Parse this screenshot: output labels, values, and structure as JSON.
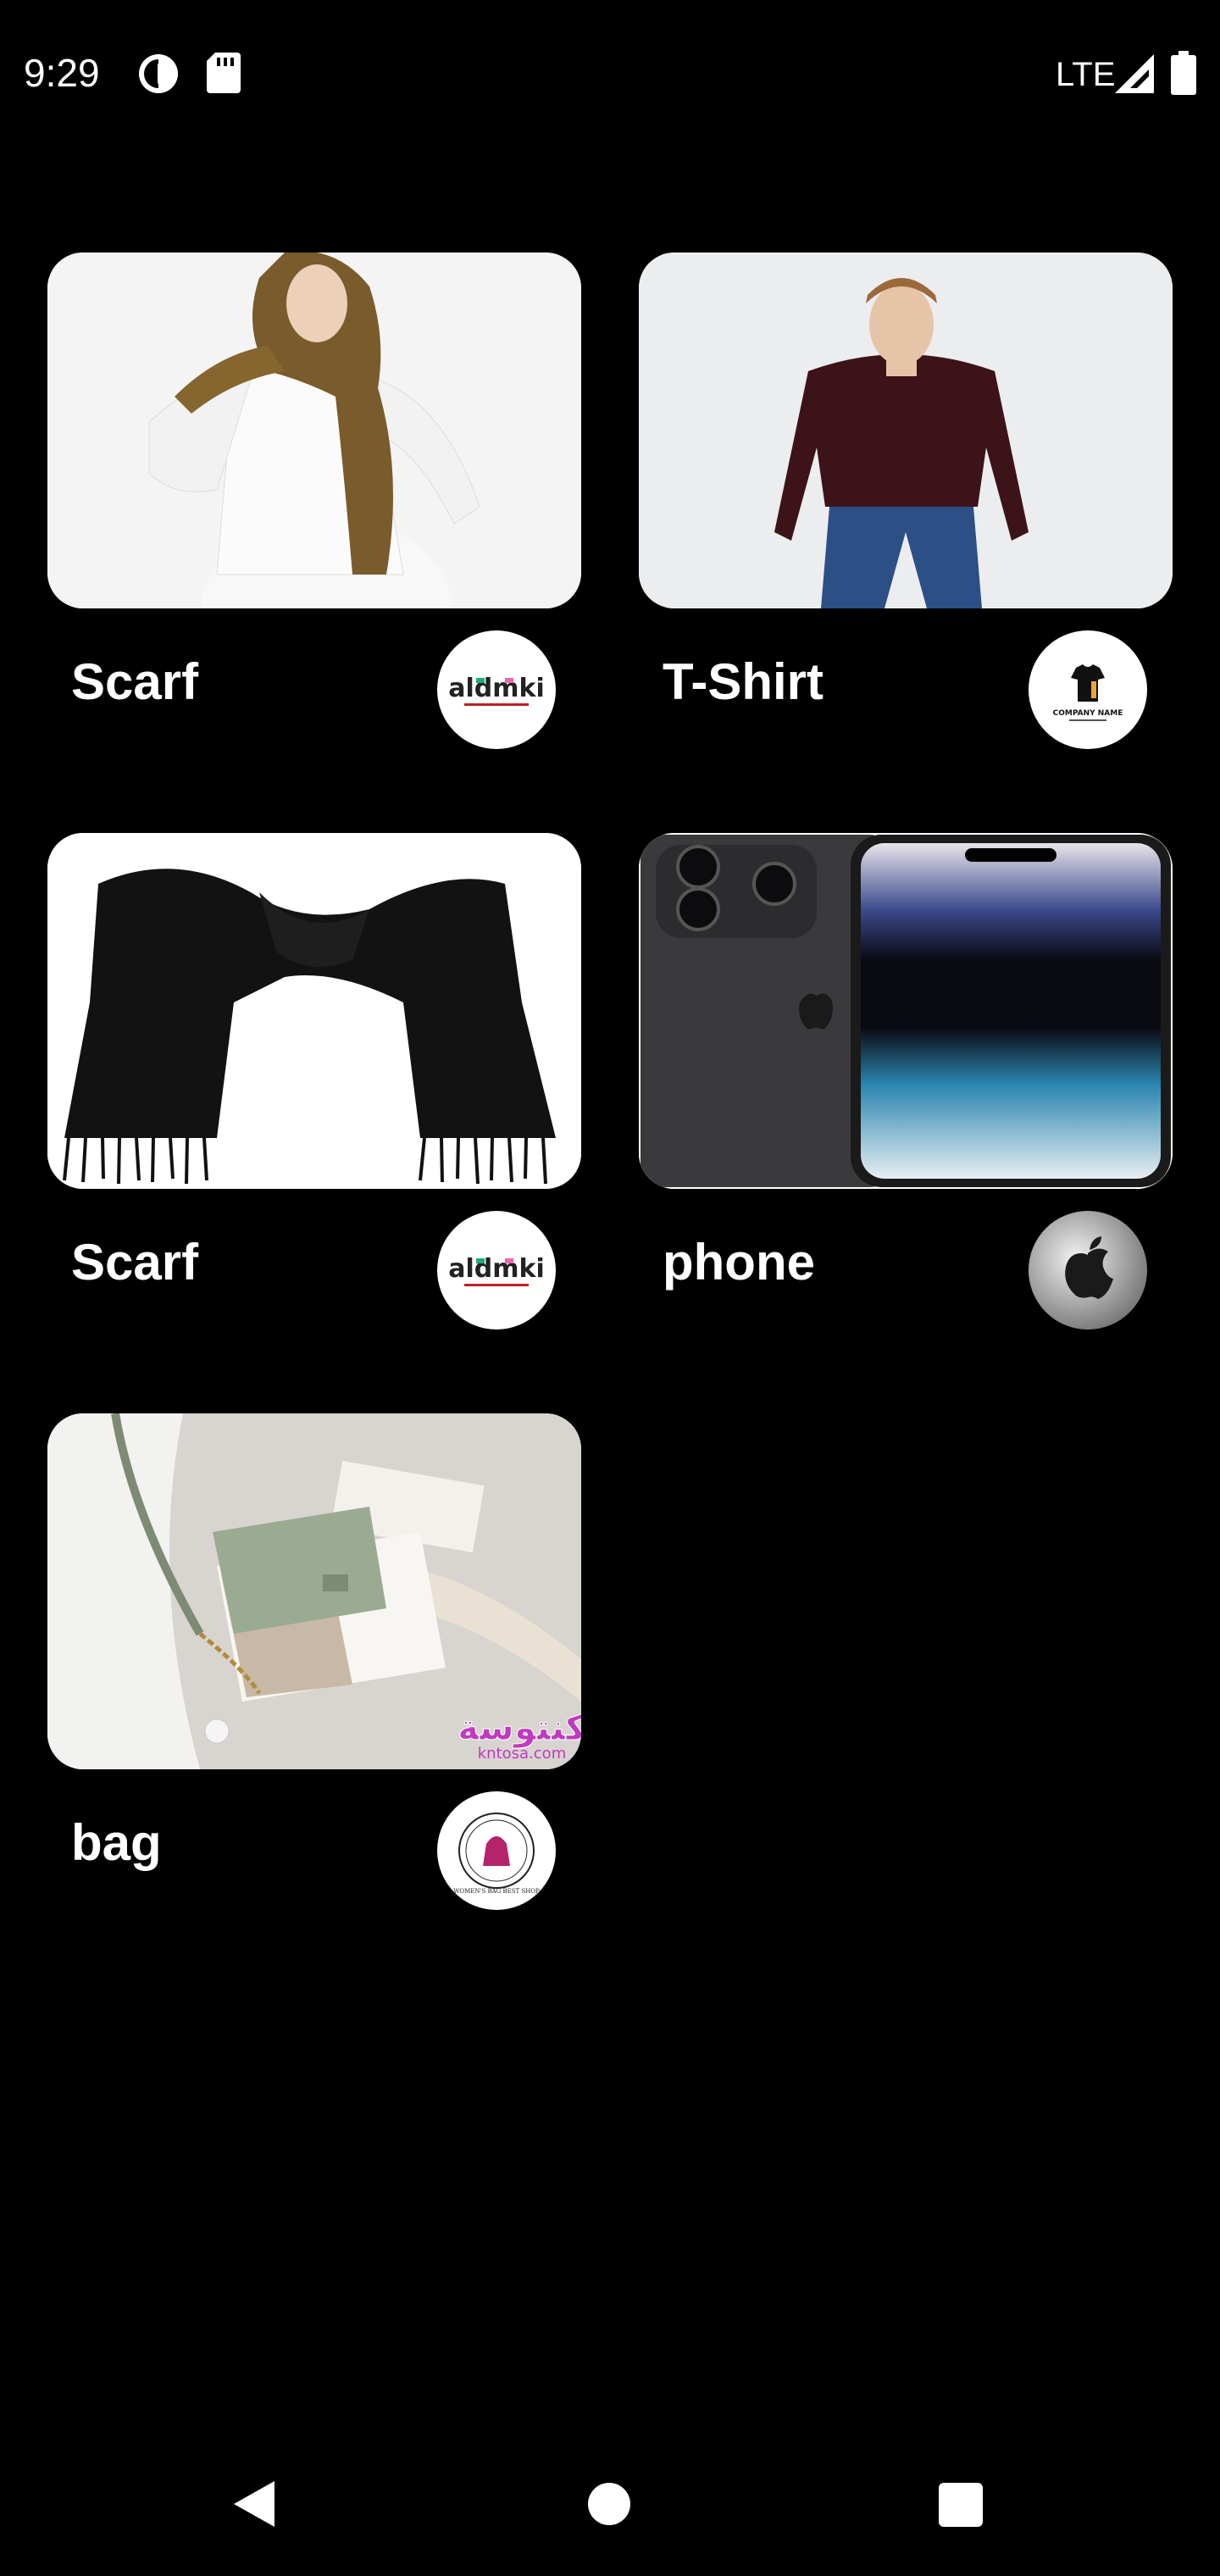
{
  "status_bar": {
    "time": "9:29",
    "network": "LTE",
    "icons": [
      "data-saver-icon",
      "sd-card-icon",
      "signal-icon",
      "battery-icon"
    ]
  },
  "products": [
    {
      "title": "Scarf",
      "image_icon": "hijab-scarf-photo",
      "brand_icon": "aldmki-logo",
      "brand_text": "aldmki"
    },
    {
      "title": "T-Shirt",
      "image_icon": "long-sleeve-shirt-photo",
      "brand_icon": "company-name-logo",
      "brand_text": "COMPANY NAME"
    },
    {
      "title": "Scarf",
      "image_icon": "black-scarf-photo",
      "brand_icon": "aldmki-logo",
      "brand_text": "aldmki"
    },
    {
      "title": "phone",
      "image_icon": "iphone-photo",
      "brand_icon": "apple-logo"
    },
    {
      "title": "bag",
      "image_icon": "handbag-photo",
      "brand_icon": "womens-bag-shop-logo",
      "brand_text": "WOMEN'S BAG BEST SHOP",
      "image_watermark": "كنتوسة",
      "image_watermark_url": "kntosa.com"
    }
  ],
  "nav_bar": {
    "icons": [
      "back-icon",
      "home-icon",
      "recents-icon"
    ]
  },
  "colors": {
    "background": "#000000",
    "text": "#ffffff",
    "card_image_bg": "#eeeeee",
    "logo_bg": "#ffffff"
  }
}
